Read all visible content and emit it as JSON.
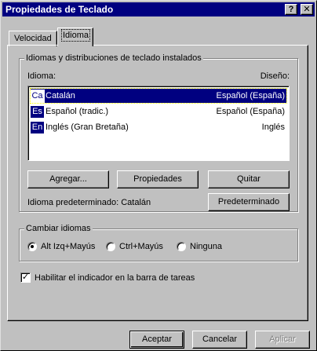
{
  "window": {
    "title": "Propiedades de Teclado",
    "help_glyph": "?",
    "close_glyph": "✕"
  },
  "tabs": [
    {
      "label": "Velocidad",
      "active": false
    },
    {
      "label": "Idioma",
      "active": true
    }
  ],
  "installed_group": {
    "legend": "Idiomas y distribuciones de teclado instalados",
    "col_language": "Idioma:",
    "col_layout": "Diseño:",
    "rows": [
      {
        "code": "Ca",
        "language": "Catalán",
        "layout": "Español (España)",
        "selected": true
      },
      {
        "code": "Es",
        "language": "Español (tradic.)",
        "layout": "Español (España)",
        "selected": false
      },
      {
        "code": "En",
        "language": "Inglés (Gran Bretaña)",
        "layout": "Inglés",
        "selected": false
      }
    ],
    "add_button": "Agregar...",
    "properties_button": "Propiedades",
    "remove_button": "Quitar",
    "default_language_label": "Idioma predeterminado: Catalán",
    "set_default_button": "Predeterminado"
  },
  "switch_group": {
    "legend": "Cambiar idiomas",
    "options": [
      {
        "label": "Alt Izq+Mayús",
        "selected": true
      },
      {
        "label": "Ctrl+Mayús",
        "selected": false
      },
      {
        "label": "Ninguna",
        "selected": false
      }
    ]
  },
  "indicator": {
    "label": "Habilitar el indicador en la barra de tareas",
    "checked": true,
    "check_glyph": "✓"
  },
  "footer": {
    "accept": "Aceptar",
    "cancel": "Cancelar",
    "apply": "Aplicar"
  },
  "colors": {
    "face": "#c0c0c0",
    "title_bar": "#000080",
    "selection": "#000080"
  }
}
